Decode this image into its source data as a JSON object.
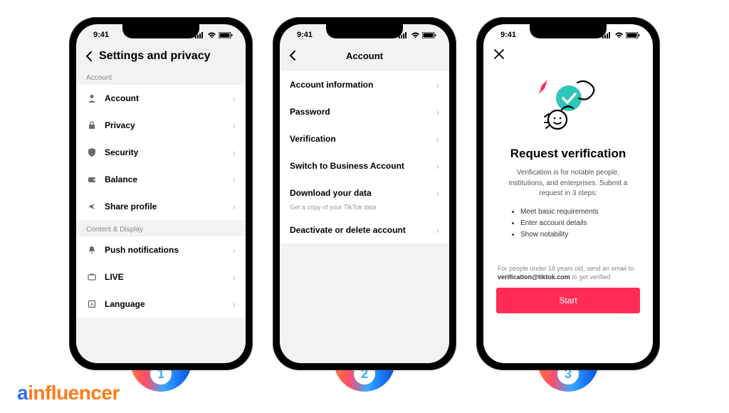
{
  "status": {
    "time": "9:41"
  },
  "screen1": {
    "title": "Settings and privacy",
    "sections": [
      {
        "label": "Account",
        "items": [
          {
            "icon": "person-icon",
            "label": "Account"
          },
          {
            "icon": "lock-icon",
            "label": "Privacy"
          },
          {
            "icon": "shield-icon",
            "label": "Security"
          },
          {
            "icon": "wallet-icon",
            "label": "Balance"
          },
          {
            "icon": "share-icon",
            "label": "Share profile"
          }
        ]
      },
      {
        "label": "Content & Display",
        "items": [
          {
            "icon": "bell-icon",
            "label": "Push notifications"
          },
          {
            "icon": "tv-icon",
            "label": "LIVE"
          },
          {
            "icon": "globe-icon",
            "label": "Language"
          }
        ]
      }
    ]
  },
  "screen2": {
    "title": "Account",
    "items": [
      {
        "label": "Account information"
      },
      {
        "label": "Password"
      },
      {
        "label": "Verification"
      },
      {
        "label": "Switch to Business Account"
      },
      {
        "label": "Download your data",
        "sub": "Get a copy of your TikTok data"
      },
      {
        "label": "Deactivate or delete account"
      }
    ]
  },
  "screen3": {
    "title": "Request verification",
    "desc": "Verification is for notable people, institutions, and enterprises. Submit a request in 3 steps:",
    "bullets": [
      "Meet basic requirements",
      "Enter account details",
      "Show notability"
    ],
    "ageNote": "For people under 18 years old, send an email to ",
    "ageEmail": "verification@tiktok.com",
    "ageNote2": " to get verified.",
    "cta": "Start"
  },
  "badges": [
    "1",
    "2",
    "3"
  ],
  "brand": {
    "a": "a",
    "rest": "influencer"
  }
}
